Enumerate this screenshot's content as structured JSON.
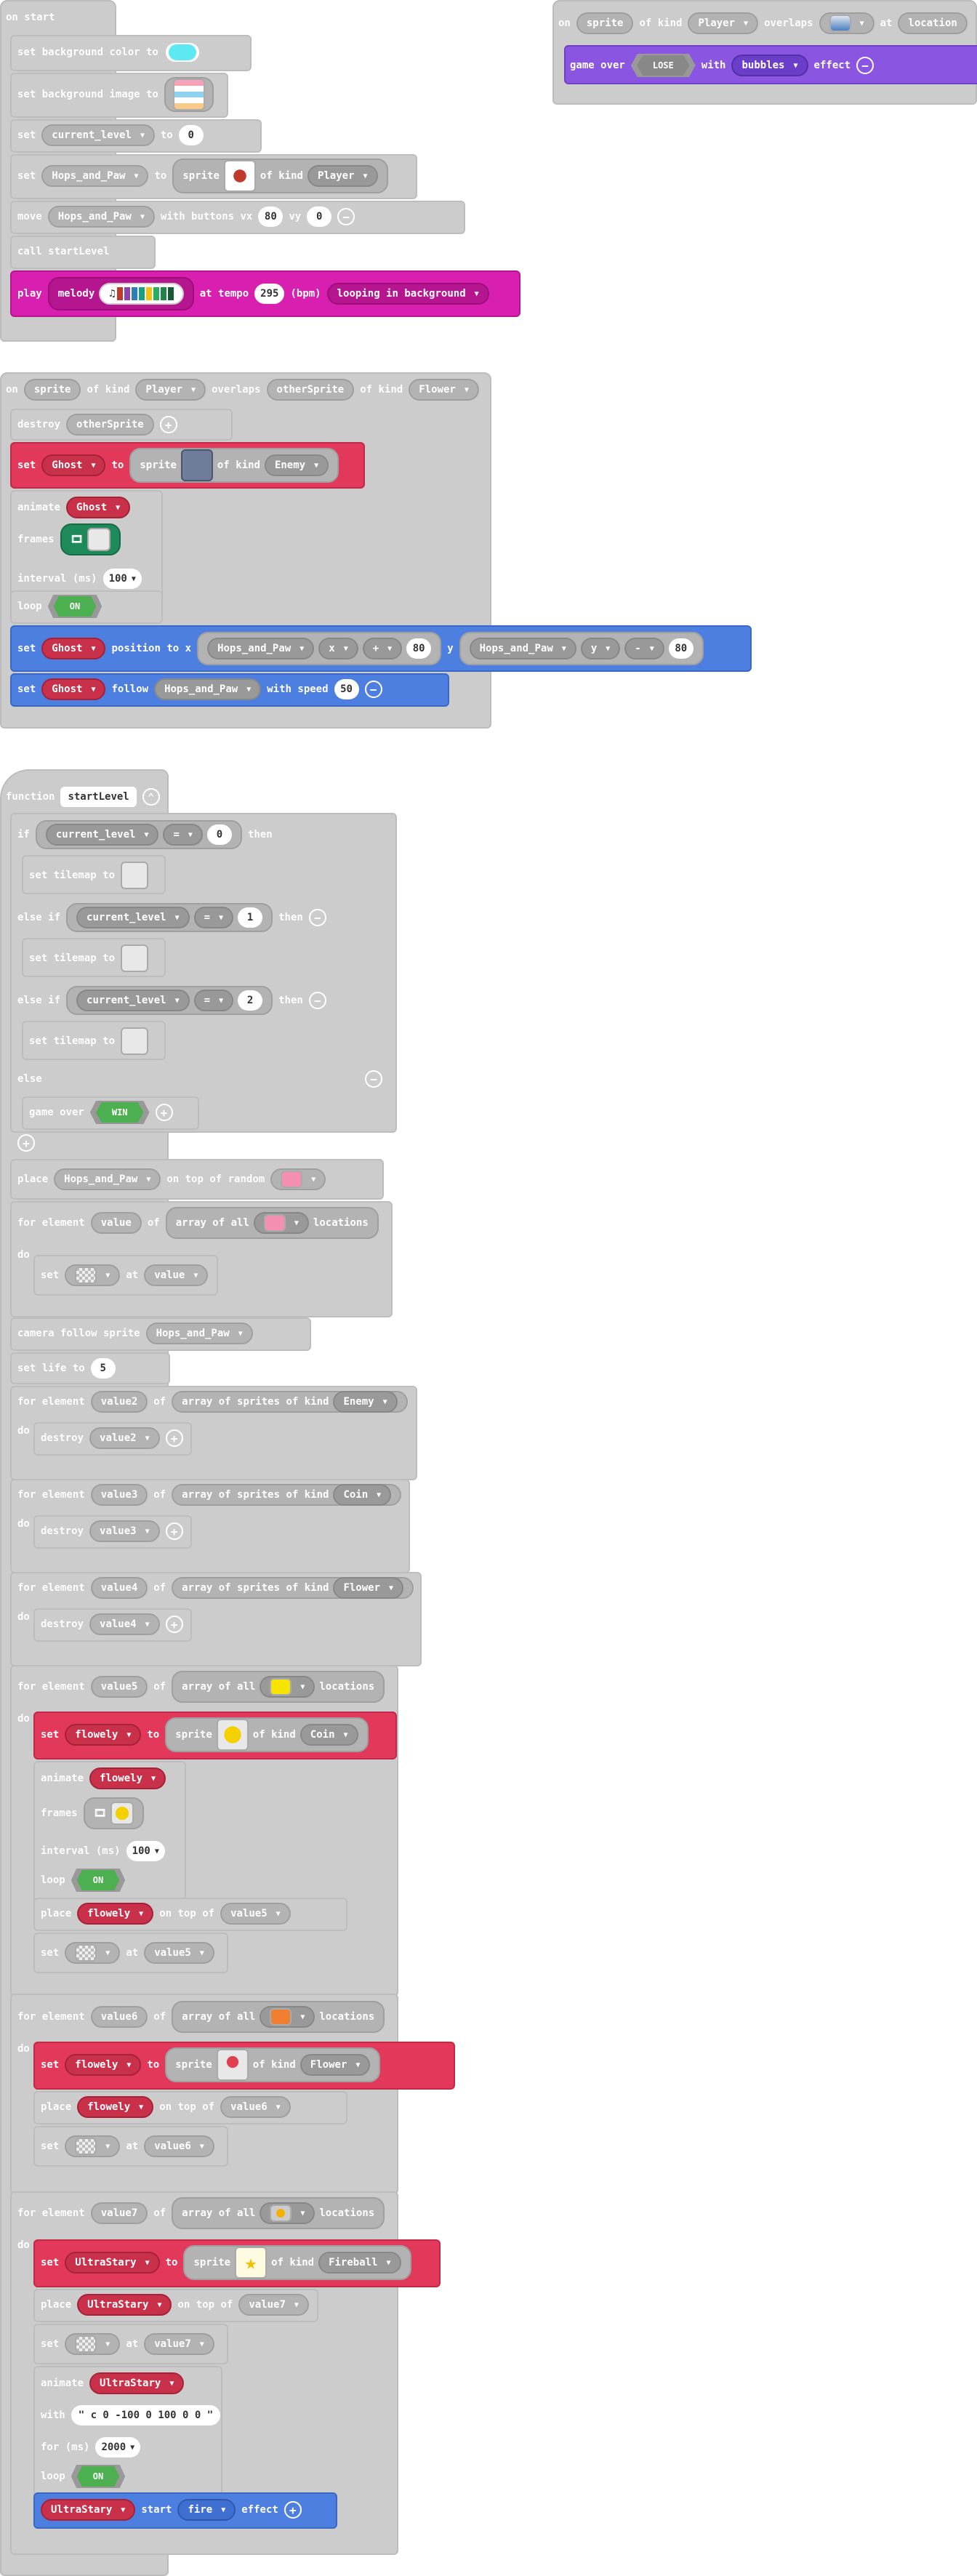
{
  "on_start": {
    "header": "on start",
    "set_bg_color": "set background color to",
    "set_bg_image": "set background image to",
    "set_var": {
      "kw": "set",
      "var": "current_level",
      "to": "to",
      "value": "0"
    },
    "set_sprite": {
      "kw": "set",
      "var": "Hops_and_Paw",
      "to": "to",
      "sprite": "sprite",
      "of_kind": "of kind",
      "kind": "Player"
    },
    "move": {
      "kw": "move",
      "var": "Hops_and_Paw",
      "with": "with buttons vx",
      "vx": "80",
      "vy_label": "vy",
      "vy": "0"
    },
    "call": "call startLevel",
    "play": {
      "kw": "play",
      "melody": "melody",
      "at_tempo": "at tempo",
      "tempo": "295",
      "bpm": "(bpm)",
      "looping": "looping in background"
    }
  },
  "overlap1": {
    "on": "on",
    "sprite": "sprite",
    "of_kind": "of kind",
    "kind": "Player",
    "overlaps": "overlaps",
    "at": "at",
    "location": "location",
    "game_over": "game over",
    "lose": "LOSE",
    "with": "with",
    "bubbles": "bubbles",
    "effect": "effect"
  },
  "overlap2": {
    "on": "on",
    "sprite": "sprite",
    "of_kind": "of kind",
    "kind": "Player",
    "overlaps": "overlaps",
    "other": "otherSprite",
    "of_kind2": "of kind",
    "kind2": "Flower",
    "destroy": "destroy",
    "destroy_var": "otherSprite",
    "set": "set",
    "ghost": "Ghost",
    "to": "to",
    "sprite_kw": "sprite",
    "of_kind3": "of kind",
    "enemy": "Enemy",
    "animate": "animate",
    "frames": "frames",
    "interval": "interval (ms)",
    "interval_val": "100",
    "loop": "loop",
    "on_val": "ON",
    "position": "position to x",
    "hops": "Hops_and_Paw",
    "x": "x",
    "plus": "+",
    "eighty": "80",
    "y": "y",
    "minus": "-",
    "follow": "follow",
    "with_speed": "with speed",
    "speed": "50"
  },
  "function": {
    "kw": "function",
    "name": "startLevel",
    "if": "if",
    "else_if": "else if",
    "else": "else",
    "then": "then",
    "eq": "=",
    "cur": "current_level",
    "v0": "0",
    "v1": "1",
    "v2": "2",
    "set_tilemap": "set tilemap to",
    "game_over": "game over",
    "win": "WIN",
    "place": "place",
    "hops": "Hops_and_Paw",
    "on_top_random": "on top of random",
    "for_element": "for element",
    "value": "value",
    "of": "of",
    "array_all": "array of all",
    "locations": "locations",
    "do": "do",
    "set": "set",
    "at": "at",
    "camera": "camera follow sprite",
    "set_life": "set life to",
    "life": "5",
    "value2": "value2",
    "value3": "value3",
    "value4": "value4",
    "value5": "value5",
    "value6": "value6",
    "value7": "value7",
    "array_sprites": "array of sprites of kind",
    "enemy": "Enemy",
    "coin": "Coin",
    "flower": "Flower",
    "fireball": "Fireball",
    "destroy": "destroy",
    "flowely": "flowely",
    "to": "to",
    "sprite": "sprite",
    "of_kind": "of kind",
    "animate": "animate",
    "frames": "frames",
    "interval": "interval (ms)",
    "interval_val": "100",
    "loop": "loop",
    "on_val": "ON",
    "on_top_of": "on top of",
    "ultra": "UltraStary",
    "with": "with",
    "path": "\" c 0 -100 0 100 0 0 \"",
    "for_ms": "for (ms)",
    "ms": "2000",
    "start": "start",
    "fire": "fire",
    "effect": "effect"
  },
  "colors": {
    "bg_color_swatch": "#5ee8f2",
    "magenta": "#d81fb0",
    "red": "#e2385a",
    "blue": "#4d7fe0",
    "purple": "#8a55e0"
  }
}
